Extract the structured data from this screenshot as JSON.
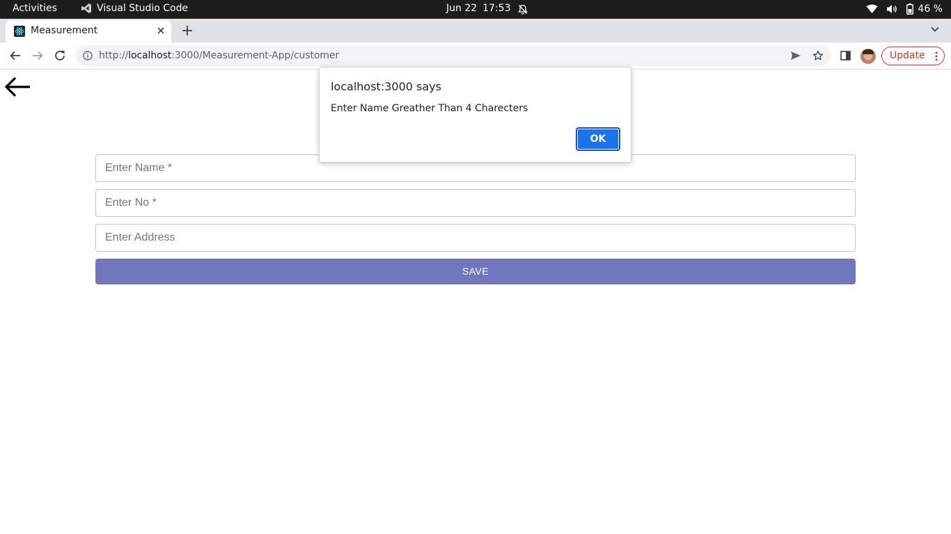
{
  "os_bar": {
    "activities": "Activities",
    "app_name": "Visual Studio Code",
    "date": "Jun 22",
    "time": "17:53",
    "battery": "46 %"
  },
  "browser": {
    "tab_title": "Measurement",
    "url_scheme": "http://",
    "url_host": "localhost",
    "url_rest": ":3000/Measurement-App/customer",
    "update_label": "Update",
    "accent_color": "#1a73e8",
    "update_color": "#d93025"
  },
  "form": {
    "name_placeholder": "Enter Name *",
    "number_placeholder": "Enter No *",
    "address_placeholder": "Enter Address",
    "save_label": "SAVE",
    "save_color": "#7077bd"
  },
  "alert": {
    "origin": "localhost:3000 says",
    "message": "Enter Name Greather Than 4 Charecters",
    "ok_label": "OK"
  },
  "icons": {
    "back": "arrow-left-icon",
    "favicon": "react-icon",
    "vscode": "vscode-icon"
  }
}
